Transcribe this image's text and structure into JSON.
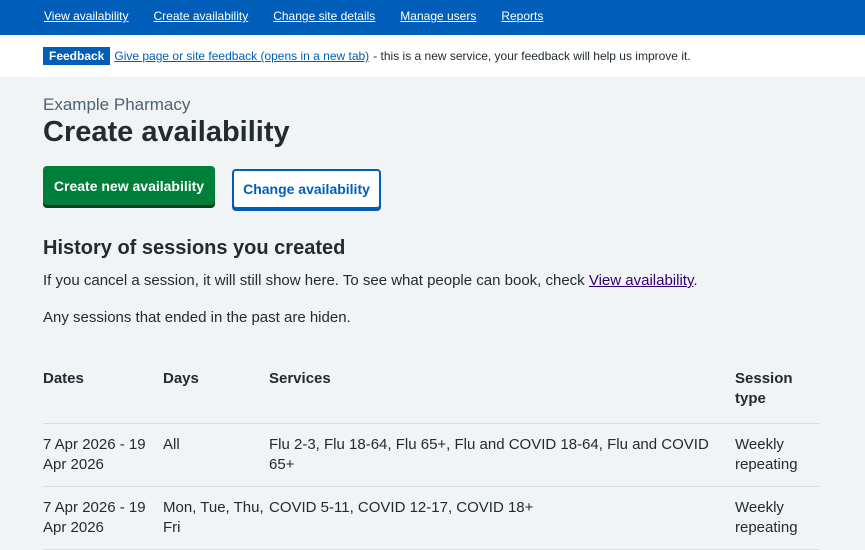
{
  "nav": {
    "items": [
      "View availability",
      "Create availability",
      "Change site details",
      "Manage users",
      "Reports"
    ]
  },
  "feedback": {
    "tag": "Feedback",
    "link": "Give page or site feedback (opens in a new tab)",
    "rest": "- this is a new service, your feedback will help us improve it."
  },
  "page": {
    "site_name": "Example Pharmacy",
    "title": "Create availability",
    "primary_button": "Create new availability",
    "secondary_button": "Change availability",
    "history_heading": "History of sessions you created",
    "cancel_text": "If you cancel a session, it will still show here. To see what people can book, check",
    "cancel_link": "View availability",
    "cancel_end": ".",
    "past_text": "Any sessions that ended in the past are hiden."
  },
  "table": {
    "headers": [
      "Dates",
      "Days",
      "Services",
      "Session type"
    ],
    "rows": [
      [
        "7 Apr 2026 - 19 Apr 2026",
        "All",
        "Flu 2-3, Flu 18-64, Flu 65+, Flu and COVID 18-64, Flu and COVID 65+",
        "Weekly repeating"
      ],
      [
        "7 Apr 2026 - 19 Apr 2026",
        "Mon, Tue, Thu, Fri",
        "COVID 5-11, COVID 12-17, COVID 18+",
        "Weekly repeating"
      ]
    ]
  }
}
